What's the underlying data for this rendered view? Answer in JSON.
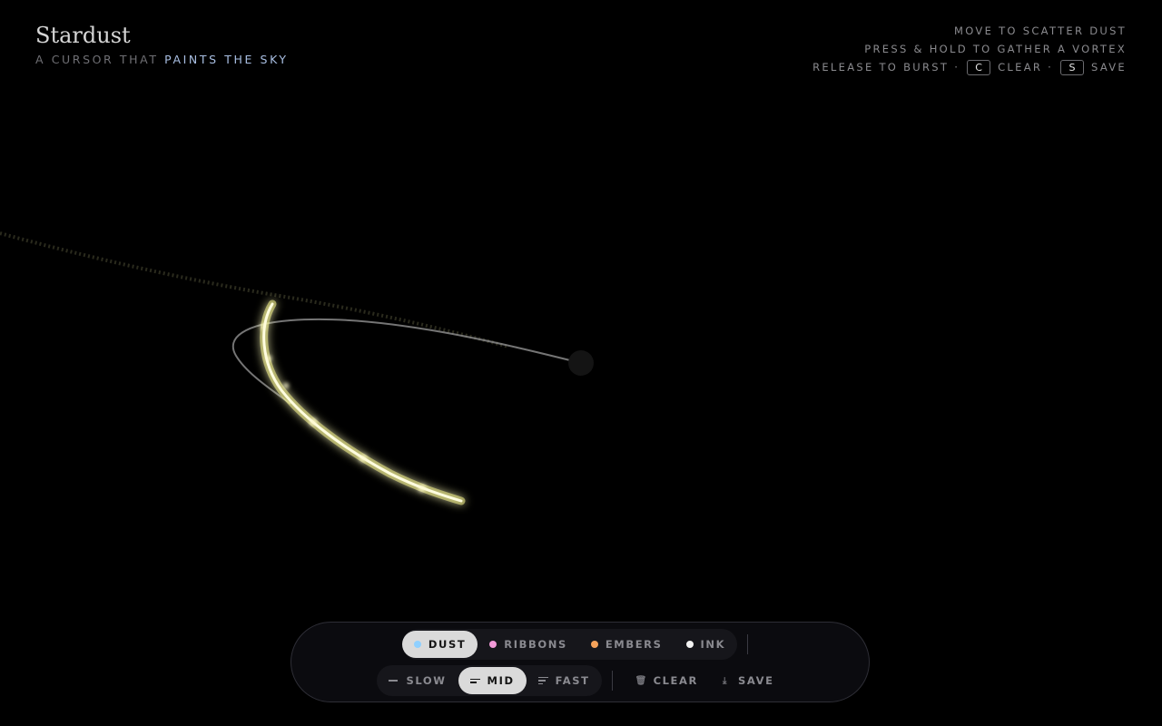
{
  "header": {
    "title": "Stardust",
    "tagline_prefix": "A CURSOR THAT ",
    "tagline_accent": "PAINTS THE SKY"
  },
  "hints": {
    "line1": "MOVE TO SCATTER DUST",
    "line2": "PRESS & HOLD TO GATHER A VORTEX",
    "line3_prefix": "RELEASE TO BURST ·",
    "clear_key": "C",
    "clear_label": "CLEAR ·",
    "save_key": "S",
    "save_label": "SAVE"
  },
  "modes": [
    {
      "label": "DUST",
      "color": "#8fd0ff",
      "active": true
    },
    {
      "label": "RIBBONS",
      "color": "#f29ad8",
      "active": false
    },
    {
      "label": "EMBERS",
      "color": "#f5a25a",
      "active": false
    },
    {
      "label": "INK",
      "color": "#f2f2f2",
      "active": false
    }
  ],
  "speeds": [
    {
      "label": "SLOW",
      "icon": "single-line-icon",
      "active": false
    },
    {
      "label": "MID",
      "icon": "two-lines-icon",
      "active": true
    },
    {
      "label": "FAST",
      "icon": "three-lines-icon",
      "active": false
    }
  ],
  "actions": {
    "clear": "CLEAR",
    "clear_icon": "trash-icon",
    "save": "SAVE",
    "save_icon": "download-icon"
  },
  "colors": {
    "stroke_glow": "#f4f27a",
    "trail_dark": "#2a2a1c",
    "cursor_ring": "#1a1a1a"
  }
}
